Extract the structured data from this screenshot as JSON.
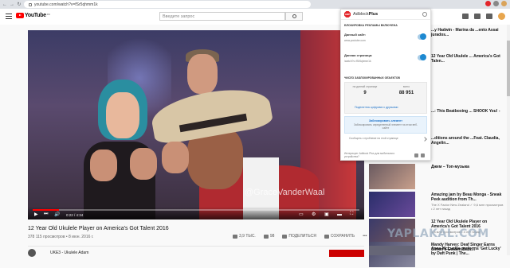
{
  "browser": {
    "url": "youtube.com/watch?v=fSr5qhmm1k"
  },
  "youtube": {
    "logo_text": "YouTube",
    "logo_region": "RU",
    "search_placeholder": "Введите запрос"
  },
  "video": {
    "watermark": "@GraceVanderWaal",
    "time": "0:22 / 4:34",
    "progress_fraction": 0.08,
    "title": "12 Year Old Ukulele Player on America's Got Talent 2016",
    "views": "378 115 просмотров • 8 июн. 2016 г.",
    "likes": "3,9 ТЫС.",
    "dislikes": "98",
    "share_label": "ПОДЕЛИТЬСЯ",
    "save_label": "СОХРАНИТЬ",
    "channel": "UKE3 - Ukulele Adam"
  },
  "sidebar": {
    "items": [
      {
        "title": "...y Hadwin - Marina da ...ento Assai jurados...",
        "meta": ""
      },
      {
        "title": "12 Year Old Ukulele ... America's Got Talen...",
        "meta": ""
      },
      {
        "title": "...: This Beatboxing ... SHOOK You! -",
        "meta": ""
      },
      {
        "title": "...ditions around the ...Feat. Claudia, Angelin...",
        "meta": ""
      },
      {
        "title": "Джем – Топ-музыка",
        "meta": ""
      },
      {
        "title": "Amazing jam by Beau Monga - Sneak Peek audition from Th...",
        "meta": "The X Factor New Zealand ✓ 9,6 млн просмотров • 2 лет назад"
      },
      {
        "title": "12 Year Old Ukulele Player on America's Got Talent 2016",
        "meta": "1,8 млн просмотров • 4 лет назад"
      },
      {
        "title": "Mandy Harvey: Deaf Singer Earns Simon's Golden Buzz...",
        "meta": "America's Got Talent ✓"
      },
      {
        "title": "Anna McLuckie performs 'Get Lucky' by Daft Punk | The...",
        "meta": ""
      }
    ]
  },
  "adblock": {
    "brand_prefix": "Adblock",
    "brand_suffix": "Plus",
    "logo_text": "ABP",
    "blocking_enabled": "БЛОКИРОВКА РЕКЛАМЫ ВКЛЮЧЕНА",
    "this_site_label": "Данный сайт:",
    "this_site_value": "www.youtube.com",
    "this_page_label": "Данная страница:",
    "this_page_value": "/watch?v=fSr5qhmm1k",
    "blocked_header": "ЧИСЛО ЗАБЛОКИРОВАННЫХ ОБЪЕКТОВ",
    "on_page_label": "на данной странице",
    "total_label": "всего",
    "on_page_value": "9",
    "total_value": "88 951",
    "share_link": "Поделитесь цифрами с друзьями",
    "block_element_title": "Заблокировать элемент",
    "block_element_desc": "Заблокировать определенный элемент на этом веб-сайте",
    "report_issue": "Сообщить о проблеме на этой странице",
    "footer": "Интересует Adblock Plus для мобильного устройства?"
  },
  "yaplakal": "YAPLAKAL.COM",
  "colors": {
    "youtube_red": "#ff0000",
    "abp_red": "#e3262b",
    "abp_blue": "#1d89d1"
  }
}
